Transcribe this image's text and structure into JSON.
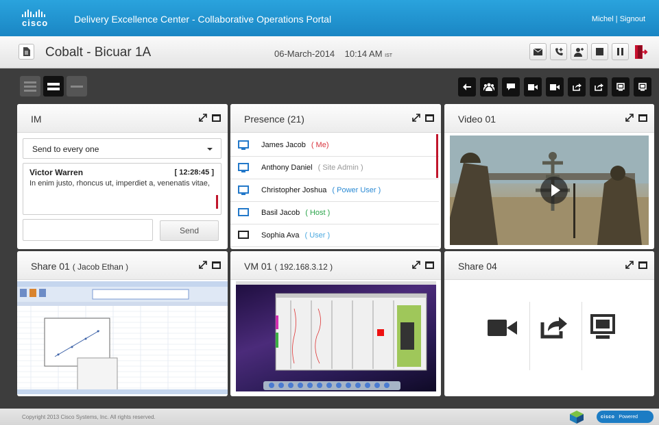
{
  "app": {
    "logo_text": "cisco",
    "title": "Delivery Excellence Center - Collaborative Operations Portal",
    "user": "Michel",
    "separator": "|",
    "signout": "Signout"
  },
  "session": {
    "name": "Cobalt - Bicuar 1A",
    "date": "06-March-2014",
    "time": "10:14 AM",
    "tz": "IST"
  },
  "session_tools": [
    "envelope-icon",
    "phone-add-icon",
    "add-user-icon",
    "stop-icon",
    "pause-icon",
    "exit-icon"
  ],
  "toolbar_actions": [
    "back-icon",
    "group-icon",
    "chat-icon",
    "video-icon",
    "video-icon",
    "share-icon",
    "share-icon",
    "screen-icon",
    "screen-icon"
  ],
  "im": {
    "title": "IM",
    "recipient": "Send to every one",
    "sender": "Victor Warren",
    "time": "[ 12:28:45 ]",
    "text": "In enim justo, rhoncus ut, imperdiet a, venenatis vitae,",
    "send_label": "Send"
  },
  "presence": {
    "title": "Presence (21)",
    "users": [
      {
        "name": "James Jacob",
        "role": "( Me)",
        "role_color": "#d9343e",
        "status": "blue"
      },
      {
        "name": "Anthony Daniel",
        "role": "( Site Admin )",
        "role_color": "#999999",
        "status": "blue"
      },
      {
        "name": "Christopher Joshua",
        "role": "( Power User )",
        "role_color": "#2a8ad4",
        "status": "blue"
      },
      {
        "name": "Basil Jacob",
        "role": "( Host )",
        "role_color": "#2aa44a",
        "status": "blue-outline"
      },
      {
        "name": "Sophia Ava",
        "role": "( User )",
        "role_color": "#4aa8e0",
        "status": "black-outline"
      }
    ]
  },
  "video": {
    "title": "Video 01"
  },
  "share1": {
    "title": "Share 01",
    "sub": "( Jacob Ethan )"
  },
  "vm": {
    "title": "VM 01",
    "sub": "( 192.168.3.12 )"
  },
  "share4": {
    "title": "Share 04"
  },
  "footer": {
    "copyright": "Copyright 2013 Cisco Systems, Inc. All rights reserved.",
    "powered_logo": "cisco",
    "powered_label": "Powered"
  }
}
